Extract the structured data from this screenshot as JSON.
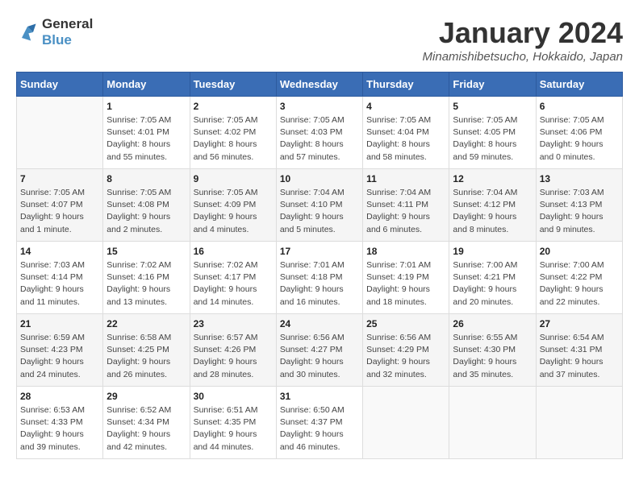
{
  "logo": {
    "line1": "General",
    "line2": "Blue"
  },
  "title": "January 2024",
  "subtitle": "Minamishibetsucho, Hokkaido, Japan",
  "weekdays": [
    "Sunday",
    "Monday",
    "Tuesday",
    "Wednesday",
    "Thursday",
    "Friday",
    "Saturday"
  ],
  "weeks": [
    [
      {
        "day": "",
        "info": ""
      },
      {
        "day": "1",
        "info": "Sunrise: 7:05 AM\nSunset: 4:01 PM\nDaylight: 8 hours\nand 55 minutes."
      },
      {
        "day": "2",
        "info": "Sunrise: 7:05 AM\nSunset: 4:02 PM\nDaylight: 8 hours\nand 56 minutes."
      },
      {
        "day": "3",
        "info": "Sunrise: 7:05 AM\nSunset: 4:03 PM\nDaylight: 8 hours\nand 57 minutes."
      },
      {
        "day": "4",
        "info": "Sunrise: 7:05 AM\nSunset: 4:04 PM\nDaylight: 8 hours\nand 58 minutes."
      },
      {
        "day": "5",
        "info": "Sunrise: 7:05 AM\nSunset: 4:05 PM\nDaylight: 8 hours\nand 59 minutes."
      },
      {
        "day": "6",
        "info": "Sunrise: 7:05 AM\nSunset: 4:06 PM\nDaylight: 9 hours\nand 0 minutes."
      }
    ],
    [
      {
        "day": "7",
        "info": "Sunrise: 7:05 AM\nSunset: 4:07 PM\nDaylight: 9 hours\nand 1 minute."
      },
      {
        "day": "8",
        "info": "Sunrise: 7:05 AM\nSunset: 4:08 PM\nDaylight: 9 hours\nand 2 minutes."
      },
      {
        "day": "9",
        "info": "Sunrise: 7:05 AM\nSunset: 4:09 PM\nDaylight: 9 hours\nand 4 minutes."
      },
      {
        "day": "10",
        "info": "Sunrise: 7:04 AM\nSunset: 4:10 PM\nDaylight: 9 hours\nand 5 minutes."
      },
      {
        "day": "11",
        "info": "Sunrise: 7:04 AM\nSunset: 4:11 PM\nDaylight: 9 hours\nand 6 minutes."
      },
      {
        "day": "12",
        "info": "Sunrise: 7:04 AM\nSunset: 4:12 PM\nDaylight: 9 hours\nand 8 minutes."
      },
      {
        "day": "13",
        "info": "Sunrise: 7:03 AM\nSunset: 4:13 PM\nDaylight: 9 hours\nand 9 minutes."
      }
    ],
    [
      {
        "day": "14",
        "info": "Sunrise: 7:03 AM\nSunset: 4:14 PM\nDaylight: 9 hours\nand 11 minutes."
      },
      {
        "day": "15",
        "info": "Sunrise: 7:02 AM\nSunset: 4:16 PM\nDaylight: 9 hours\nand 13 minutes."
      },
      {
        "day": "16",
        "info": "Sunrise: 7:02 AM\nSunset: 4:17 PM\nDaylight: 9 hours\nand 14 minutes."
      },
      {
        "day": "17",
        "info": "Sunrise: 7:01 AM\nSunset: 4:18 PM\nDaylight: 9 hours\nand 16 minutes."
      },
      {
        "day": "18",
        "info": "Sunrise: 7:01 AM\nSunset: 4:19 PM\nDaylight: 9 hours\nand 18 minutes."
      },
      {
        "day": "19",
        "info": "Sunrise: 7:00 AM\nSunset: 4:21 PM\nDaylight: 9 hours\nand 20 minutes."
      },
      {
        "day": "20",
        "info": "Sunrise: 7:00 AM\nSunset: 4:22 PM\nDaylight: 9 hours\nand 22 minutes."
      }
    ],
    [
      {
        "day": "21",
        "info": "Sunrise: 6:59 AM\nSunset: 4:23 PM\nDaylight: 9 hours\nand 24 minutes."
      },
      {
        "day": "22",
        "info": "Sunrise: 6:58 AM\nSunset: 4:25 PM\nDaylight: 9 hours\nand 26 minutes."
      },
      {
        "day": "23",
        "info": "Sunrise: 6:57 AM\nSunset: 4:26 PM\nDaylight: 9 hours\nand 28 minutes."
      },
      {
        "day": "24",
        "info": "Sunrise: 6:56 AM\nSunset: 4:27 PM\nDaylight: 9 hours\nand 30 minutes."
      },
      {
        "day": "25",
        "info": "Sunrise: 6:56 AM\nSunset: 4:29 PM\nDaylight: 9 hours\nand 32 minutes."
      },
      {
        "day": "26",
        "info": "Sunrise: 6:55 AM\nSunset: 4:30 PM\nDaylight: 9 hours\nand 35 minutes."
      },
      {
        "day": "27",
        "info": "Sunrise: 6:54 AM\nSunset: 4:31 PM\nDaylight: 9 hours\nand 37 minutes."
      }
    ],
    [
      {
        "day": "28",
        "info": "Sunrise: 6:53 AM\nSunset: 4:33 PM\nDaylight: 9 hours\nand 39 minutes."
      },
      {
        "day": "29",
        "info": "Sunrise: 6:52 AM\nSunset: 4:34 PM\nDaylight: 9 hours\nand 42 minutes."
      },
      {
        "day": "30",
        "info": "Sunrise: 6:51 AM\nSunset: 4:35 PM\nDaylight: 9 hours\nand 44 minutes."
      },
      {
        "day": "31",
        "info": "Sunrise: 6:50 AM\nSunset: 4:37 PM\nDaylight: 9 hours\nand 46 minutes."
      },
      {
        "day": "",
        "info": ""
      },
      {
        "day": "",
        "info": ""
      },
      {
        "day": "",
        "info": ""
      }
    ]
  ]
}
